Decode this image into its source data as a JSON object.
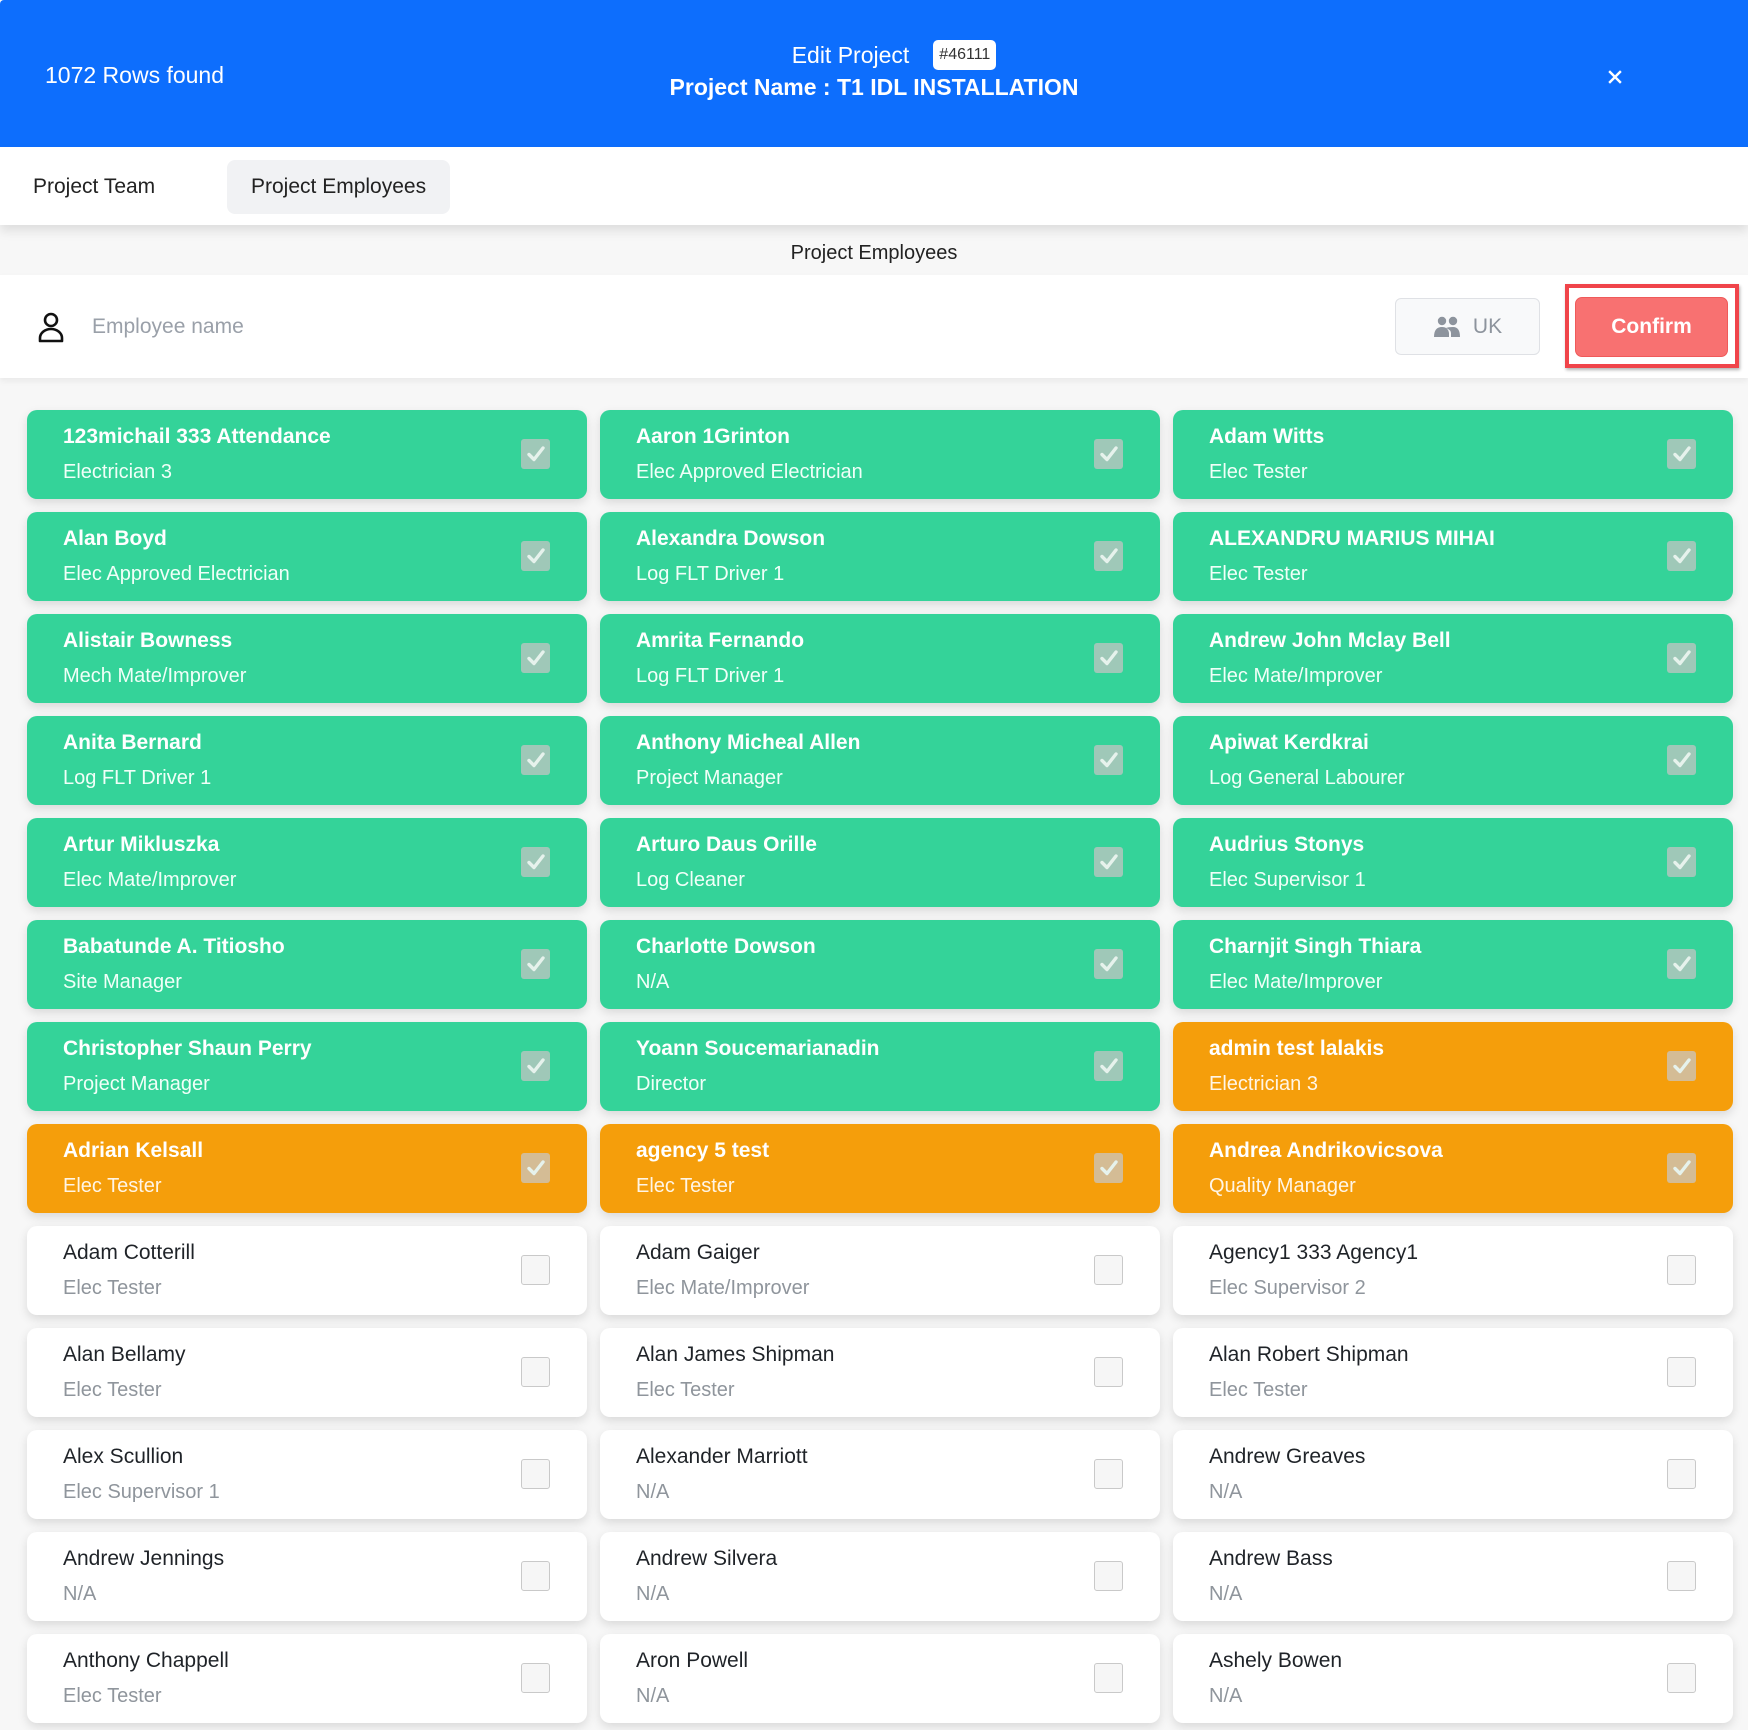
{
  "header": {
    "rows_found": "1072 Rows found",
    "title": "Edit Project",
    "project_id_badge": "#46111",
    "project_name": "Project Name : T1 IDL INSTALLATION",
    "close_label": "x",
    "background_color": "#0d6efd"
  },
  "tabs": [
    {
      "label": "Project Team",
      "active": false
    },
    {
      "label": "Project Employees",
      "active": true
    }
  ],
  "section_title": "Project Employees",
  "search": {
    "placeholder": "Employee name",
    "value": "",
    "icon": "person-icon"
  },
  "region_button": {
    "label": "UK",
    "icon": "people-icon"
  },
  "confirm_button": {
    "label": "Confirm",
    "color": "#f87171",
    "highlighted": true
  },
  "status_colors": {
    "assigned": "#34d399",
    "agency": "#f59e0b",
    "unassigned": "#ffffff"
  },
  "employees": [
    {
      "name": "123michail 333 Attendance",
      "role": "Electrician 3",
      "status": "green",
      "checked": true
    },
    {
      "name": "Aaron 1Grinton",
      "role": "Elec Approved Electrician",
      "status": "green",
      "checked": true
    },
    {
      "name": "Adam Witts",
      "role": "Elec Tester",
      "status": "green",
      "checked": true
    },
    {
      "name": "Alan Boyd",
      "role": "Elec Approved Electrician",
      "status": "green",
      "checked": true
    },
    {
      "name": "Alexandra Dowson",
      "role": "Log FLT Driver 1",
      "status": "green",
      "checked": true
    },
    {
      "name": "ALEXANDRU MARIUS MIHAI",
      "role": "Elec Tester",
      "status": "green",
      "checked": true
    },
    {
      "name": "Alistair Bowness",
      "role": "Mech Mate/Improver",
      "status": "green",
      "checked": true
    },
    {
      "name": "Amrita Fernando",
      "role": "Log FLT Driver 1",
      "status": "green",
      "checked": true
    },
    {
      "name": "Andrew John Mclay Bell",
      "role": "Elec Mate/Improver",
      "status": "green",
      "checked": true
    },
    {
      "name": "Anita Bernard",
      "role": "Log FLT Driver 1",
      "status": "green",
      "checked": true
    },
    {
      "name": "Anthony Micheal Allen",
      "role": "Project Manager",
      "status": "green",
      "checked": true
    },
    {
      "name": "Apiwat Kerdkrai",
      "role": "Log General Labourer",
      "status": "green",
      "checked": true
    },
    {
      "name": "Artur Mikluszka",
      "role": "Elec Mate/Improver",
      "status": "green",
      "checked": true
    },
    {
      "name": "Arturo Daus Orille",
      "role": "Log Cleaner",
      "status": "green",
      "checked": true
    },
    {
      "name": "Audrius Stonys",
      "role": "Elec Supervisor 1",
      "status": "green",
      "checked": true
    },
    {
      "name": "Babatunde A. Titiosho",
      "role": "Site Manager",
      "status": "green",
      "checked": true
    },
    {
      "name": "Charlotte Dowson",
      "role": "N/A",
      "status": "green",
      "checked": true
    },
    {
      "name": "Charnjit Singh Thiara",
      "role": "Elec Mate/Improver",
      "status": "green",
      "checked": true
    },
    {
      "name": "Christopher Shaun Perry",
      "role": "Project Manager",
      "status": "green",
      "checked": true
    },
    {
      "name": "Yoann Soucemarianadin",
      "role": "Director",
      "status": "green",
      "checked": true
    },
    {
      "name": "admin test lalakis",
      "role": "Electrician 3",
      "status": "orange",
      "checked": true
    },
    {
      "name": "Adrian Kelsall",
      "role": "Elec Tester",
      "status": "orange",
      "checked": true
    },
    {
      "name": "agency 5 test",
      "role": "Elec Tester",
      "status": "orange",
      "checked": true
    },
    {
      "name": "Andrea Andrikovicsova",
      "role": "Quality Manager",
      "status": "orange",
      "checked": true
    },
    {
      "name": "Adam Cotterill",
      "role": "Elec Tester",
      "status": "white",
      "checked": false
    },
    {
      "name": "Adam Gaiger",
      "role": "Elec Mate/Improver",
      "status": "white",
      "checked": false
    },
    {
      "name": "Agency1 333 Agency1",
      "role": "Elec Supervisor 2",
      "status": "white",
      "checked": false
    },
    {
      "name": "Alan Bellamy",
      "role": "Elec Tester",
      "status": "white",
      "checked": false
    },
    {
      "name": "Alan James Shipman",
      "role": "Elec Tester",
      "status": "white",
      "checked": false
    },
    {
      "name": "Alan Robert Shipman",
      "role": "Elec Tester",
      "status": "white",
      "checked": false
    },
    {
      "name": "Alex Scullion",
      "role": "Elec Supervisor 1",
      "status": "white",
      "checked": false
    },
    {
      "name": "Alexander Marriott",
      "role": "N/A",
      "status": "white",
      "checked": false
    },
    {
      "name": "Andrew Greaves",
      "role": "N/A",
      "status": "white",
      "checked": false
    },
    {
      "name": "Andrew Jennings",
      "role": "N/A",
      "status": "white",
      "checked": false
    },
    {
      "name": "Andrew Silvera",
      "role": "N/A",
      "status": "white",
      "checked": false
    },
    {
      "name": "Andrew Bass",
      "role": "N/A",
      "status": "white",
      "checked": false
    },
    {
      "name": "Anthony Chappell",
      "role": "Elec Tester",
      "status": "white",
      "checked": false
    },
    {
      "name": "Aron Powell",
      "role": "N/A",
      "status": "white",
      "checked": false
    },
    {
      "name": "Ashely Bowen",
      "role": "N/A",
      "status": "white",
      "checked": false
    }
  ]
}
